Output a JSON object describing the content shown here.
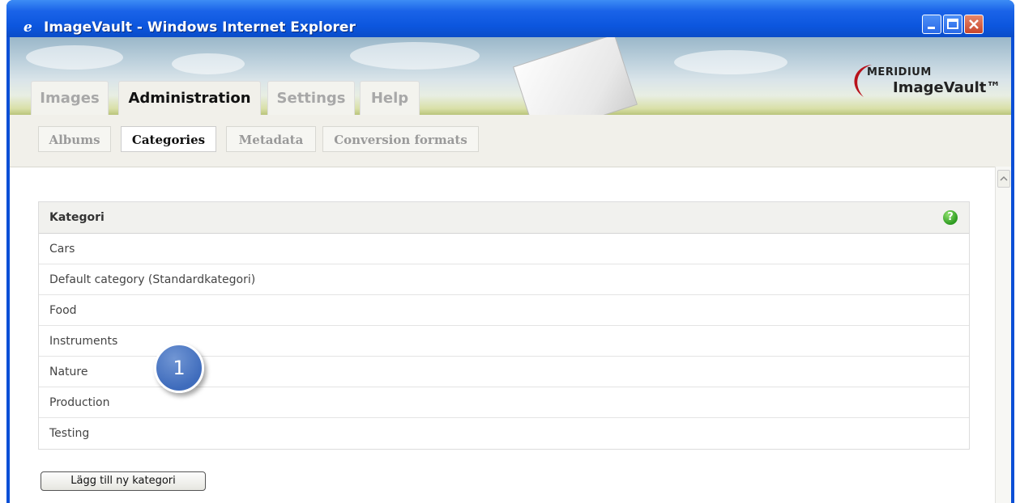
{
  "window": {
    "title": "ImageVault - Windows Internet Explorer"
  },
  "brand": {
    "logo_top": "MERIDIUM",
    "logo_bottom": "ImageVault™"
  },
  "main_tabs": [
    {
      "label": "Images",
      "active": false
    },
    {
      "label": "Administration",
      "active": true
    },
    {
      "label": "Settings",
      "active": false
    },
    {
      "label": "Help",
      "active": false
    }
  ],
  "sub_tabs": [
    {
      "label": "Albums",
      "active": false
    },
    {
      "label": "Categories",
      "active": true
    },
    {
      "label": "Metadata",
      "active": false
    },
    {
      "label": "Conversion formats",
      "active": false
    }
  ],
  "categories": {
    "header": "Kategori",
    "help_icon": "question-icon",
    "rows": [
      "Cars",
      "Default category (Standardkategori)",
      "Food",
      "Instruments",
      "Nature",
      "Production",
      "Testing"
    ]
  },
  "add_button_label": "Lägg till ny kategori",
  "callout_label": "1",
  "colors": {
    "titlebar": "#0c56de",
    "callout": "#3f6cbc",
    "help": "#2c9a1f"
  }
}
